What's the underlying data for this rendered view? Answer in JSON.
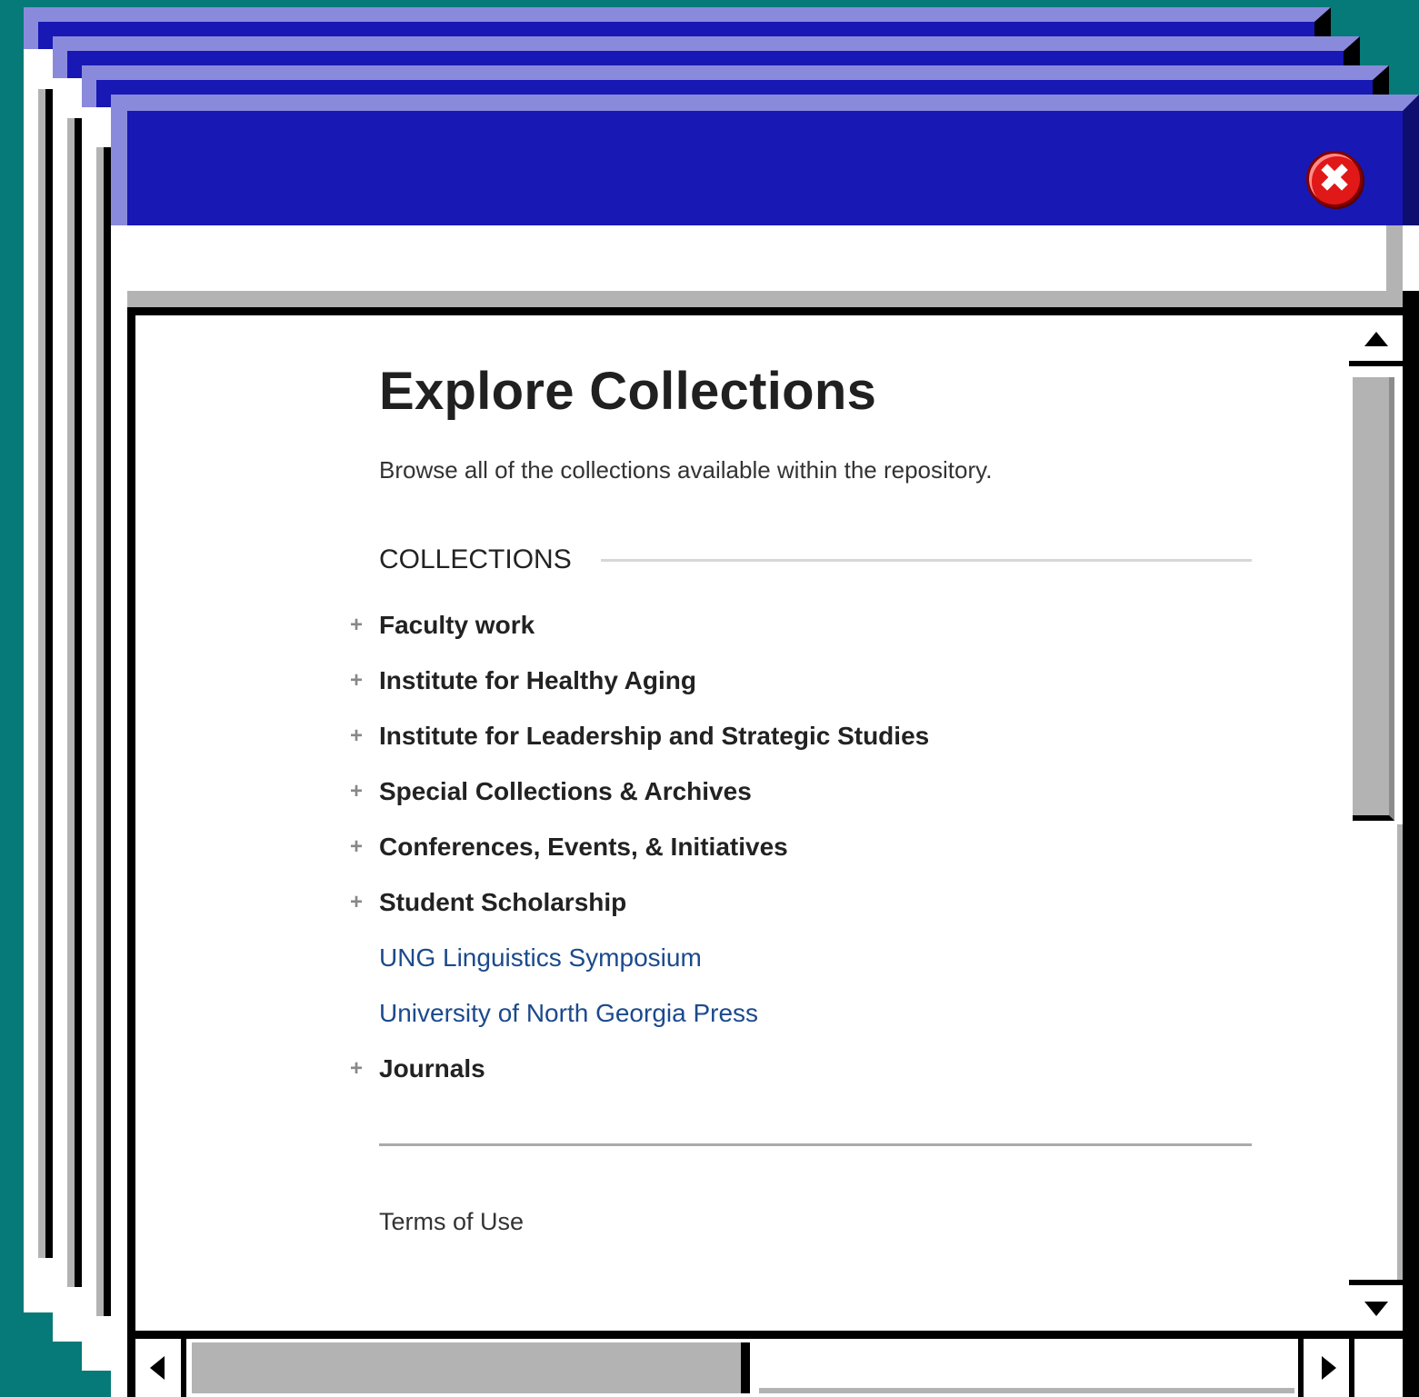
{
  "window": {
    "title": "",
    "close_symbol": "✖"
  },
  "page": {
    "heading": "Explore Collections",
    "subtitle": "Browse all of the collections available within the repository.",
    "section_label": "COLLECTIONS",
    "collections": [
      {
        "label": "Faculty work",
        "type": "parent",
        "expand": "+"
      },
      {
        "label": "Institute for Healthy Aging",
        "type": "parent",
        "expand": "+"
      },
      {
        "label": "Institute for Leadership and Strategic Studies",
        "type": "parent",
        "expand": "+"
      },
      {
        "label": "Special Collections & Archives",
        "type": "parent",
        "expand": "+"
      },
      {
        "label": "Conferences, Events, & Initiatives",
        "type": "parent",
        "expand": "+"
      },
      {
        "label": "Student Scholarship",
        "type": "parent",
        "expand": "+"
      },
      {
        "label": "UNG Linguistics Symposium",
        "type": "link",
        "expand": ""
      },
      {
        "label": "University of North Georgia Press",
        "type": "link",
        "expand": ""
      },
      {
        "label": "Journals",
        "type": "parent",
        "expand": "+"
      }
    ],
    "footer_link": "Terms of Use"
  },
  "colors": {
    "desktop": "#067a78",
    "titlebar": "#1818b4",
    "titlebar_highlight": "#8a8adc",
    "link": "#1b4a8c",
    "close_button": "#e01818"
  },
  "icons": {
    "close": "close-icon",
    "scroll_up": "arrow-up-icon",
    "scroll_down": "arrow-down-icon",
    "scroll_left": "arrow-left-icon",
    "scroll_right": "arrow-right-icon",
    "expand": "plus-icon"
  }
}
